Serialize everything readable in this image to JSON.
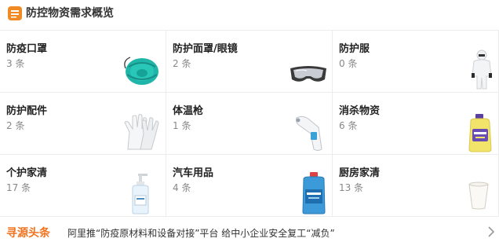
{
  "header": {
    "title": "防控物资需求概览",
    "icon": "list-icon",
    "accent": "#f08a24"
  },
  "categories": [
    {
      "name": "防疫口罩",
      "count": "3 条",
      "icon": "n95-mask-icon"
    },
    {
      "name": "防护面罩/眼镜",
      "count": "2 条",
      "icon": "goggles-icon"
    },
    {
      "name": "防护服",
      "count": "0 条",
      "icon": "protective-suit-icon"
    },
    {
      "name": "防护配件",
      "count": "2 条",
      "icon": "gloves-icon"
    },
    {
      "name": "体温枪",
      "count": "1 条",
      "icon": "thermometer-gun-icon"
    },
    {
      "name": "消杀物资",
      "count": "6 条",
      "icon": "disinfectant-bottle-icon"
    },
    {
      "name": "个护家清",
      "count": "17 条",
      "icon": "pump-bottle-icon"
    },
    {
      "name": "汽车用品",
      "count": "4 条",
      "icon": "washer-fluid-icon"
    },
    {
      "name": "厨房家清",
      "count": "13 条",
      "icon": "paper-cup-icon"
    }
  ],
  "footer": {
    "brand": "寻源头条",
    "news": "阿里推“防疫原材料和设备对接”平台 给中小企业安全复工“减负”",
    "brand_color": "#f0731f"
  }
}
